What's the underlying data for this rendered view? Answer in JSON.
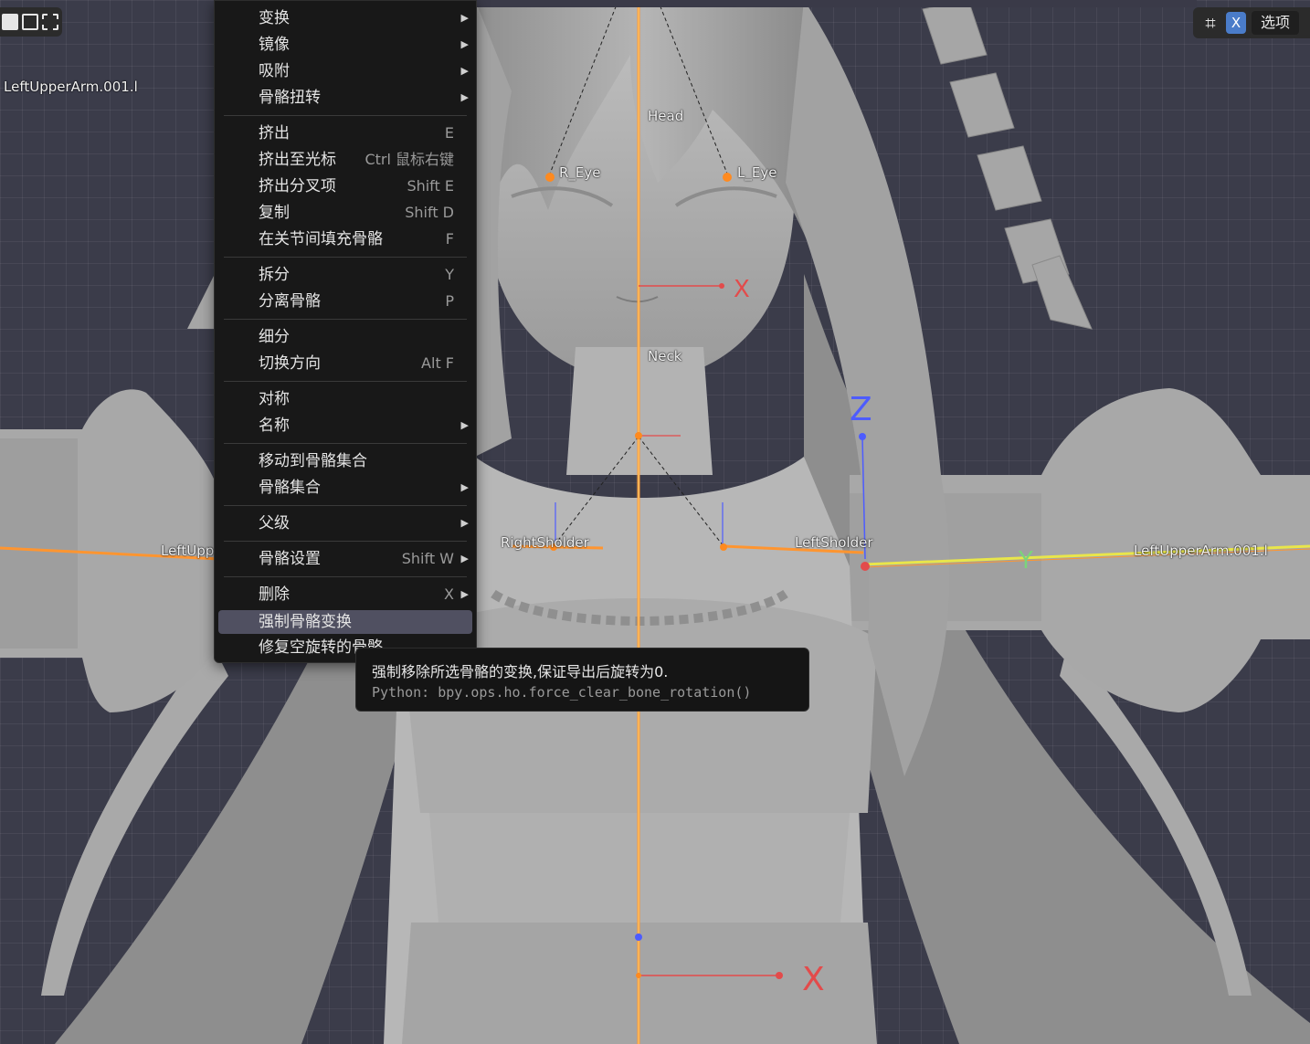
{
  "viewport": {
    "top_left_label": "LeftUpperArm.001.l",
    "bones": {
      "head": "Head",
      "r_eye": "R_Eye",
      "l_eye": "L_Eye",
      "neck": "Neck",
      "right_sholder": "RightSholder",
      "left_sholder": "LeftSholder",
      "left_upper_arm_cut": "LeftUpp",
      "left_upper_arm_right": "LeftUpperArm.001.l"
    },
    "axes": {
      "x": "X",
      "y": "Y",
      "z": "Z"
    }
  },
  "header": {
    "select_modes": [
      "select-box-icon",
      "select-extend-icon",
      "select-subtract-icon"
    ],
    "xray_icon": "xray-icon",
    "x_toggle": "X",
    "options_label": "选项"
  },
  "menu": {
    "items": [
      {
        "label": "变换",
        "shortcut": "",
        "submenu": true
      },
      {
        "label": "镜像",
        "shortcut": "",
        "submenu": true
      },
      {
        "label": "吸附",
        "shortcut": "",
        "submenu": true
      },
      {
        "label": "骨骼扭转",
        "shortcut": "",
        "submenu": true
      },
      {
        "label": "挤出",
        "shortcut": "E",
        "submenu": false
      },
      {
        "label": "挤出至光标",
        "shortcut": "Ctrl 鼠标右键",
        "submenu": false
      },
      {
        "label": "挤出分叉项",
        "shortcut": "Shift E",
        "submenu": false
      },
      {
        "label": "复制",
        "shortcut": "Shift D",
        "submenu": false
      },
      {
        "label": "在关节间填充骨骼",
        "shortcut": "F",
        "submenu": false
      },
      {
        "label": "拆分",
        "shortcut": "Y",
        "submenu": false
      },
      {
        "label": "分离骨骼",
        "shortcut": "P",
        "submenu": false
      },
      {
        "label": "细分",
        "shortcut": "",
        "submenu": false
      },
      {
        "label": "切换方向",
        "shortcut": "Alt F",
        "submenu": false
      },
      {
        "label": "对称",
        "shortcut": "",
        "submenu": false
      },
      {
        "label": "名称",
        "shortcut": "",
        "submenu": true
      },
      {
        "label": "移动到骨骼集合",
        "shortcut": "",
        "submenu": false
      },
      {
        "label": "骨骼集合",
        "shortcut": "",
        "submenu": true
      },
      {
        "label": "父级",
        "shortcut": "",
        "submenu": true
      },
      {
        "label": "骨骼设置",
        "shortcut": "Shift W",
        "submenu": true
      },
      {
        "label": "删除",
        "shortcut": "X",
        "submenu": true
      },
      {
        "label": "强制骨骼变换",
        "shortcut": "",
        "submenu": false
      },
      {
        "label": "修复空旋转的骨骼",
        "shortcut": "",
        "submenu": false
      }
    ]
  },
  "tooltip": {
    "description": "强制移除所选骨骼的变换,保证导出后旋转为0.",
    "python": "Python: bpy.ops.ho.force_clear_bone_rotation()"
  }
}
